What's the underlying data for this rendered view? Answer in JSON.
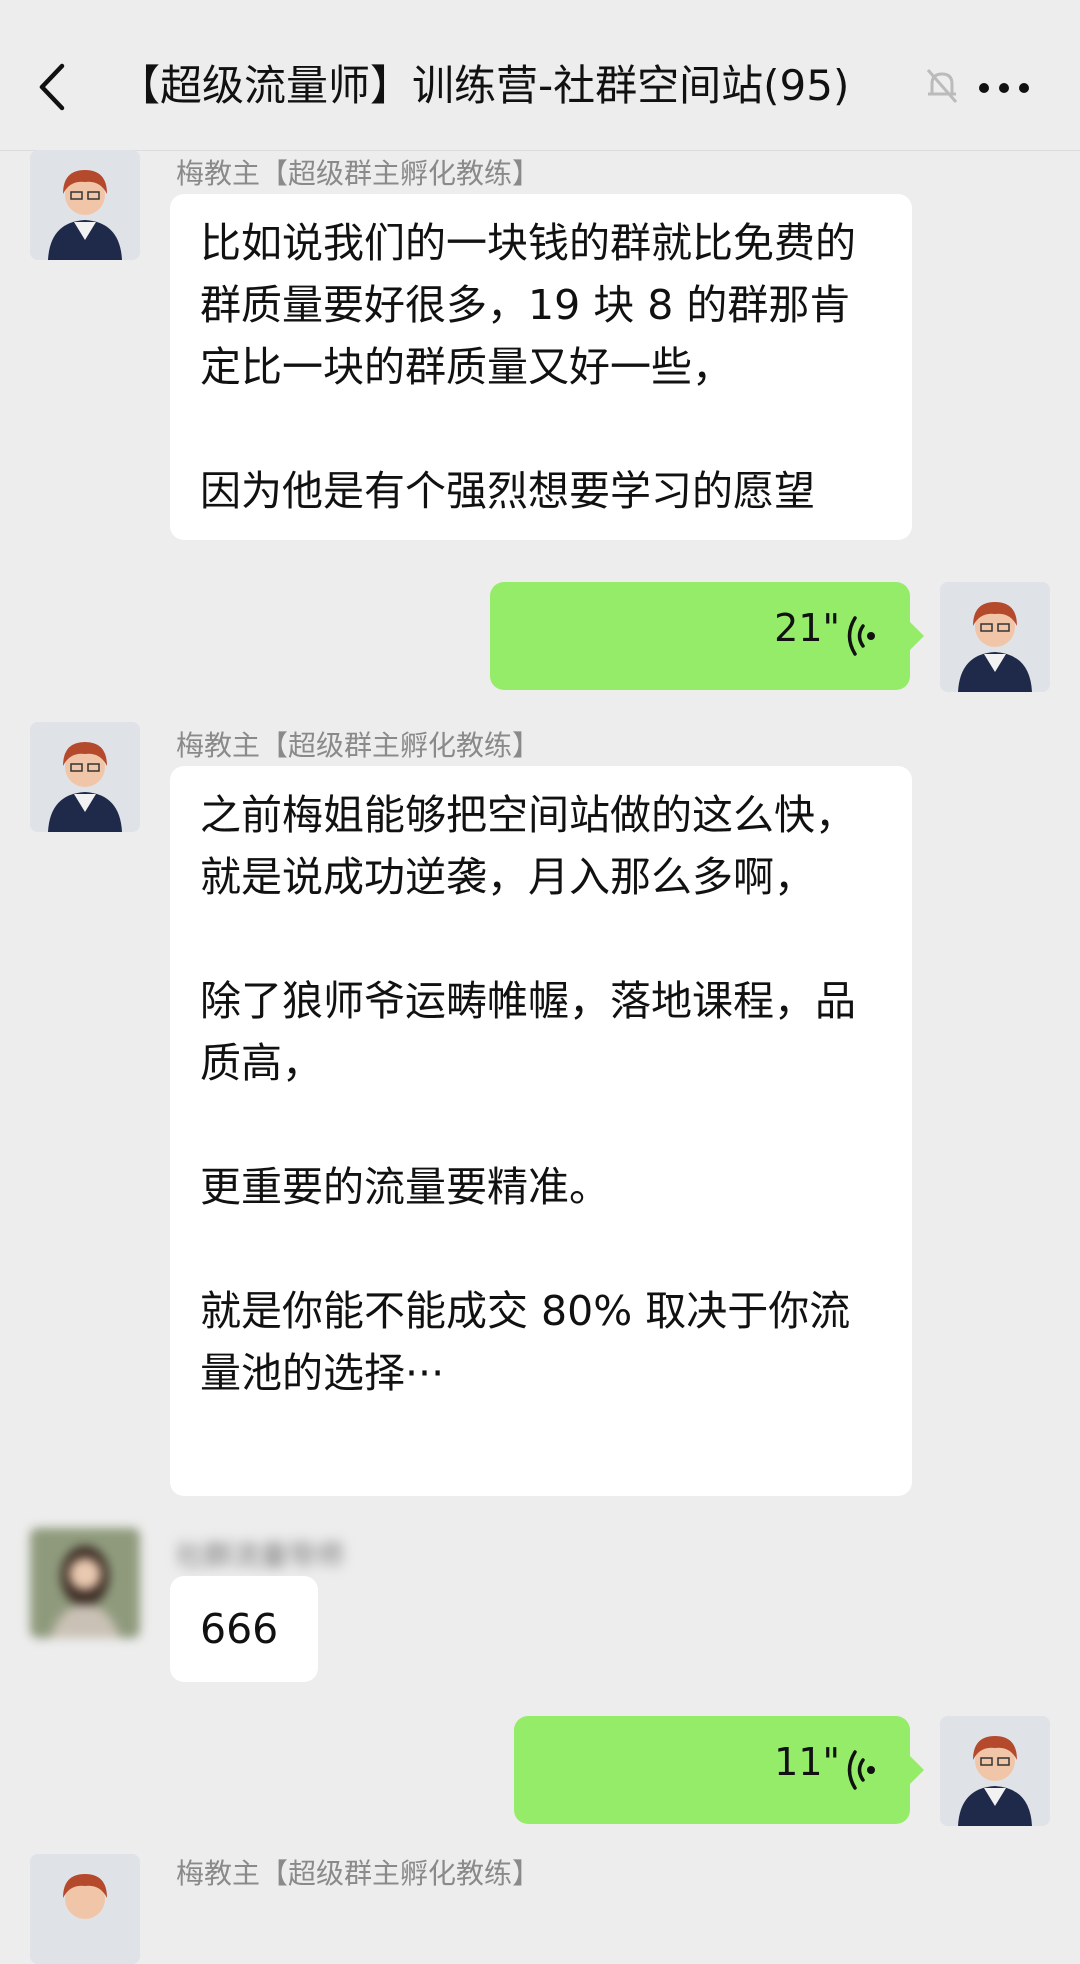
{
  "header": {
    "title": "【超级流量师】训练营-社群空间站(95)"
  },
  "messages": [
    {
      "sender": "梅教主【超级群主孵化教练】",
      "paragraphs": [
        "比如说我们的一块钱的群就比免费的群质量要好很多，19 块 8 的群那肯定比一块的群质量又好一些，",
        "因为他是有个强烈想要学习的愿望"
      ]
    },
    {
      "voice_duration": "21\""
    },
    {
      "sender": "梅教主【超级群主孵化教练】",
      "paragraphs": [
        "之前梅姐能够把空间站做的这么快，就是说成功逆袭，月入那么多啊，",
        "除了狼师爷运畴帷幄，落地课程，品质高，",
        "更重要的流量要精准。",
        "就是你能不能成交 80% 取决于你流量池的选择···"
      ]
    },
    {
      "sender": "社群流量导师",
      "text": "666"
    },
    {
      "voice_duration": "11\""
    },
    {
      "sender": "梅教主【超级群主孵化教练】"
    }
  ]
}
